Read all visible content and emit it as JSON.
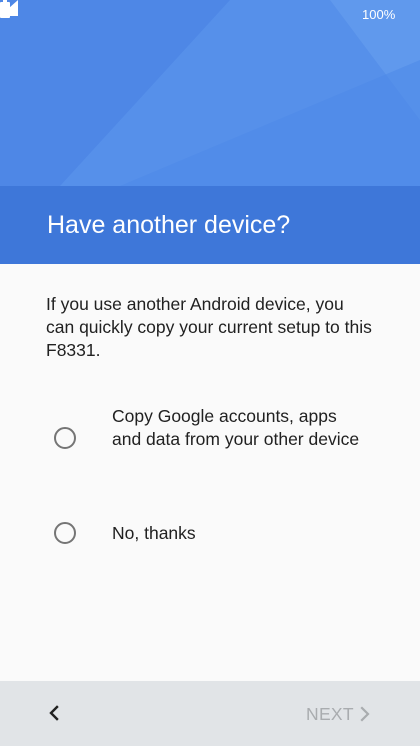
{
  "status_bar": {
    "battery_text": "100%",
    "signal_icon": "signal-icon",
    "battery_icon": "battery-full-icon"
  },
  "page": {
    "title": "Have another device?",
    "description": "If you use another Android device, you can quickly copy your current setup to this F8331."
  },
  "options": [
    {
      "label": "Copy Google accounts, apps and data from your other device",
      "selected": false
    },
    {
      "label": "No, thanks",
      "selected": false
    }
  ],
  "navigation": {
    "back_icon": "chevron-left-icon",
    "next_label": "NEXT",
    "next_icon": "chevron-right-icon",
    "next_enabled": false
  },
  "colors": {
    "hero": "#4e87e6",
    "title_band": "#3e77d9",
    "background": "#fafafa",
    "bottom_bar": "#e1e4e7",
    "disabled_text": "#a9acaf"
  }
}
